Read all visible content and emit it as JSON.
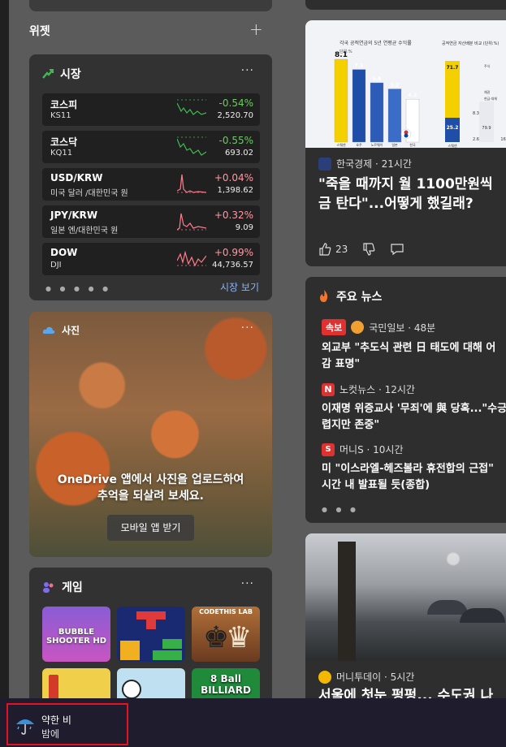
{
  "widgets_title": "위젯",
  "add_widget": "+",
  "market": {
    "title": "시장",
    "more": "···",
    "rows": [
      {
        "name": "코스피",
        "code": "KS11",
        "change": "-0.54%",
        "price": "2,520.70",
        "dir": "neg"
      },
      {
        "name": "코스닥",
        "code": "KQ11",
        "change": "-0.55%",
        "price": "693.02",
        "dir": "neg"
      },
      {
        "name": "USD/KRW",
        "code": "미국 달러 /대한민국 원",
        "change": "+0.04%",
        "price": "1,398.62",
        "dir": "pos"
      },
      {
        "name": "JPY/KRW",
        "code": "일본 엔/대한민국 원",
        "change": "+0.32%",
        "price": "9.09",
        "dir": "pos"
      },
      {
        "name": "DOW",
        "code": "DJI",
        "change": "+0.99%",
        "price": "44,736.57",
        "dir": "pos"
      }
    ],
    "pager": "● ● ● ● ●",
    "link": "시장 보기"
  },
  "photos": {
    "title": "사진",
    "more": "···",
    "message_line1": "OneDrive 앱에서 사진을 업로드하여",
    "message_line2": "추억을 되살려 보세요.",
    "button": "모바일 앱 받기"
  },
  "games": {
    "title": "게임",
    "more": "···",
    "tiles": [
      "BUBBLE SHOOTER HD",
      "",
      "CODETHIS LAB",
      "",
      "",
      "8 Ball BILLIARD"
    ]
  },
  "story1": {
    "source": "한국경제 · 21시간",
    "headline_line1": "\"죽을 때까지 월 1100만원씩",
    "headline_line2": "금 탄다\"...어떻게 했길래?",
    "likes": "23",
    "infographic": {
      "left_title": "각국 공적연금의 5년 연평균 수익률",
      "left_unit": "단위:%",
      "bars": [
        "8.1",
        "7.1",
        "5.8",
        "5.2",
        "4.2"
      ],
      "countries": [
        "스웨덴",
        "호주",
        "노르웨이",
        "일본",
        "한국"
      ],
      "right_title": "공적연금 자산배분 비교 (단위:%)",
      "right_values": [
        "71.7",
        "25.2",
        "8.3",
        "2.6",
        "79.9",
        "16.5"
      ],
      "right_labels": [
        "주식",
        "채권",
        "현금·대체",
        "스웨덴"
      ]
    }
  },
  "top_news": {
    "title": "주요 뉴스",
    "items": [
      {
        "badge": "속보",
        "source": "국민일보 · 48분",
        "line1": "외교부 \"추도식 관련 日 태도에 대해 어",
        "line2": "감 표명\""
      },
      {
        "badge": "",
        "source": "노컷뉴스 · 12시간",
        "line1": "이재명 위증교사 '무죄'에 與 당혹...\"수긍",
        "line2": "렵지만 존중\""
      },
      {
        "badge": "",
        "source": "머니S · 10시간",
        "line1": "미 \"이스라엘-헤즈볼라 휴전합의 근접\"",
        "line2": "시간 내 발표될 듯(종합)"
      }
    ],
    "pager": "● ● ●"
  },
  "story2": {
    "source": "머니투데이 · 5시간",
    "headline": "서울에 첫눈 펑펑... 수도권 나"
  },
  "taskbar": {
    "weather_line1": "약한 비",
    "weather_line2": "밤에"
  },
  "colors": {
    "negative": "#6ccb5f",
    "positive": "#ff99a4",
    "link": "#8ab4ff",
    "highlight": "#e81123"
  }
}
